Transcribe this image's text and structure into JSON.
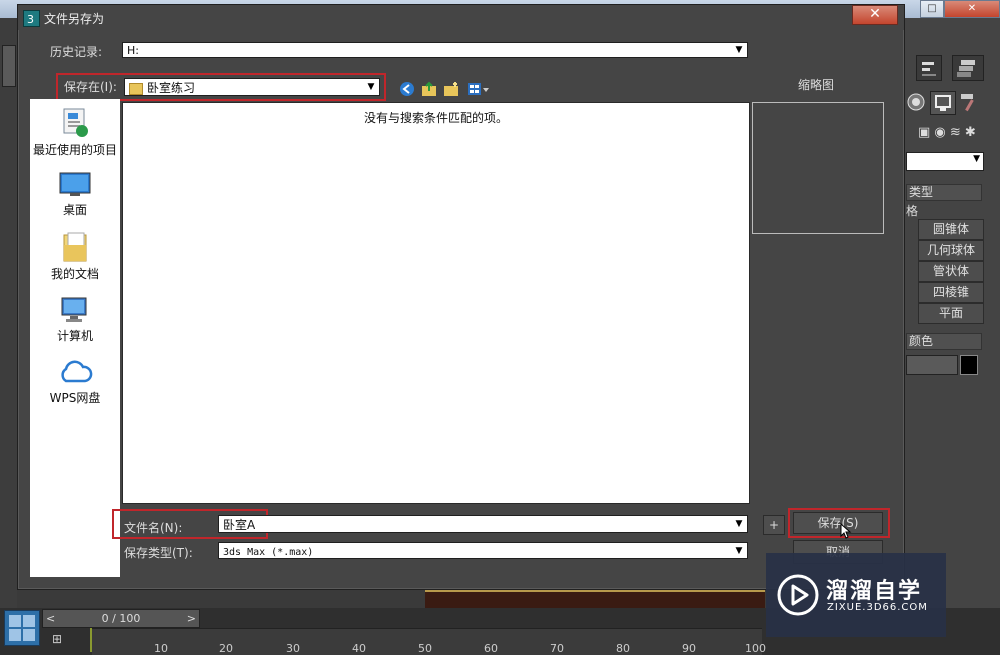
{
  "dialog": {
    "title": "文件另存为",
    "close_label": "✕",
    "history_label": "历史记录:",
    "history_value": "H:",
    "save_in_label": "保存在(I):",
    "save_in_value": "卧室练习",
    "thumbnail_label": "缩略图",
    "empty_message": "没有与搜索条件匹配的项。",
    "filename_label": "文件名(N):",
    "filename_value": "卧室A",
    "filetype_label": "保存类型(T):",
    "filetype_value": "3ds Max (*.max)",
    "plus_label": "+",
    "save_button": "保存(S)",
    "cancel_button": "取消"
  },
  "places": [
    {
      "label": "最近使用的项目",
      "icon": "recent-items-icon"
    },
    {
      "label": "桌面",
      "icon": "desktop-icon"
    },
    {
      "label": "我的文档",
      "icon": "documents-icon"
    },
    {
      "label": "计算机",
      "icon": "computer-icon"
    },
    {
      "label": "WPS网盘",
      "icon": "cloud-icon"
    }
  ],
  "right_panel": {
    "type_header": "类型",
    "grid_label": "格",
    "items": [
      "圆锥体",
      "几何球体",
      "管状体",
      "四棱锥",
      "平面"
    ],
    "color_header": "颜色"
  },
  "timeline": {
    "frame": "0 / 100",
    "prev": "<",
    "next": ">",
    "ticks": [
      "10",
      "20",
      "30",
      "40",
      "50",
      "60",
      "70",
      "80",
      "90",
      "100"
    ]
  },
  "watermark": {
    "name": "溜溜自学",
    "url": "ZIXUE.3D66.COM"
  },
  "colors": {
    "highlight": "#c0262b",
    "dialog_bg": "#454545"
  }
}
